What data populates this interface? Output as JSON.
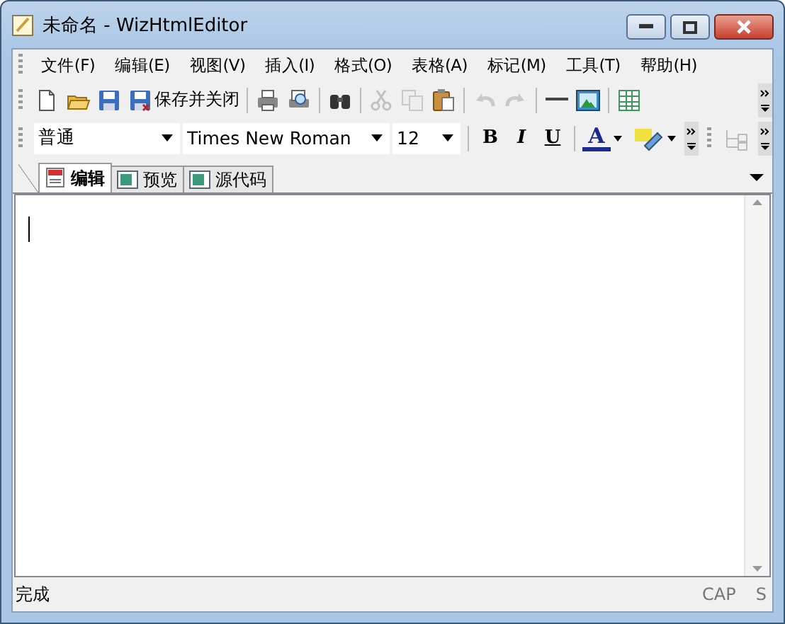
{
  "window": {
    "title": "未命名 - WizHtmlEditor"
  },
  "menu": [
    "文件(F)",
    "编辑(E)",
    "视图(V)",
    "插入(I)",
    "格式(O)",
    "表格(A)",
    "标记(M)",
    "工具(T)",
    "帮助(H)"
  ],
  "toolbar": [
    {
      "kind": "new",
      "disabled": false
    },
    {
      "kind": "open",
      "disabled": false
    },
    {
      "kind": "save",
      "disabled": false
    },
    {
      "kind": "save-close",
      "disabled": false,
      "label": "保存并关闭"
    },
    {
      "kind": "separator"
    },
    {
      "kind": "print",
      "disabled": false
    },
    {
      "kind": "preview",
      "disabled": false
    },
    {
      "kind": "separator"
    },
    {
      "kind": "find",
      "disabled": false
    },
    {
      "kind": "separator"
    },
    {
      "kind": "cut",
      "disabled": true
    },
    {
      "kind": "copy",
      "disabled": true
    },
    {
      "kind": "paste",
      "disabled": false
    },
    {
      "kind": "separator"
    },
    {
      "kind": "undo",
      "disabled": true
    },
    {
      "kind": "redo",
      "disabled": true
    },
    {
      "kind": "separator"
    },
    {
      "kind": "hline",
      "disabled": false
    },
    {
      "kind": "image",
      "disabled": false
    },
    {
      "kind": "separator"
    },
    {
      "kind": "table",
      "disabled": false
    }
  ],
  "format_bar": {
    "style": "普通",
    "font": "Times New Roman",
    "size": "12",
    "bold": "B",
    "italic": "I",
    "underline": "U",
    "font_color": "A"
  },
  "tabs": [
    {
      "label": "编辑",
      "selected": true
    },
    {
      "label": "预览",
      "selected": false
    },
    {
      "label": "源代码",
      "selected": false
    }
  ],
  "status_bar": {
    "message": "完成",
    "indicators": [
      "CAP",
      "S"
    ]
  }
}
